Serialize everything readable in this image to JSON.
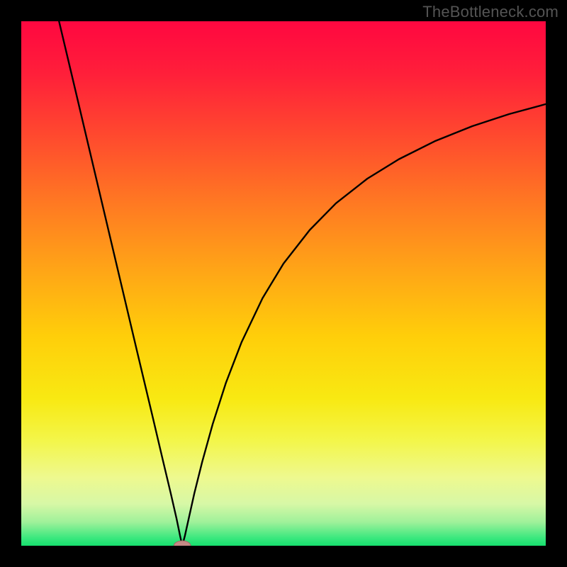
{
  "watermark": "TheBottleneck.com",
  "colors": {
    "frame": "#000000",
    "curve": "#000000",
    "marker_fill": "#c58a86",
    "marker_stroke": "#9f6a66",
    "gradient_stops": [
      {
        "offset": 0.0,
        "color": "#ff0740"
      },
      {
        "offset": 0.1,
        "color": "#ff1f3a"
      },
      {
        "offset": 0.22,
        "color": "#ff4a2e"
      },
      {
        "offset": 0.35,
        "color": "#ff7a22"
      },
      {
        "offset": 0.48,
        "color": "#ffa716"
      },
      {
        "offset": 0.6,
        "color": "#ffce0a"
      },
      {
        "offset": 0.72,
        "color": "#f8e912"
      },
      {
        "offset": 0.8,
        "color": "#f3f64a"
      },
      {
        "offset": 0.87,
        "color": "#eef98f"
      },
      {
        "offset": 0.92,
        "color": "#d7f8a6"
      },
      {
        "offset": 0.955,
        "color": "#9ff19a"
      },
      {
        "offset": 0.985,
        "color": "#3be87e"
      },
      {
        "offset": 1.0,
        "color": "#16e06e"
      }
    ]
  },
  "chart_data": {
    "type": "line",
    "title": "",
    "xlabel": "",
    "ylabel": "",
    "xlim": [
      0,
      100
    ],
    "ylim": [
      0,
      100
    ],
    "grid": false,
    "legend": false,
    "marker": {
      "x": 30.7,
      "y": 0.0,
      "rx": 1.6,
      "ry": 0.95
    },
    "comment": "V-shaped bottleneck curve. x is an arbitrary component-balance parameter (0–100). y is mismatch percentage (0=perfect, 100=worst). Left branch is nearly linear; right branch rises with diminishing slope. Values estimated from pixel positions.",
    "series": [
      {
        "name": "left-branch",
        "x": [
          7.2,
          10,
          13,
          16,
          19,
          22,
          25,
          27,
          28.5,
          29.6,
          30.3,
          30.7
        ],
        "y": [
          100,
          88.2,
          75.5,
          62.8,
          50.1,
          37.4,
          24.8,
          16.3,
          10.0,
          5.2,
          1.8,
          0.0
        ]
      },
      {
        "name": "right-branch",
        "x": [
          30.7,
          31.2,
          32,
          33,
          34.5,
          36.5,
          39,
          42,
          46,
          50,
          55,
          60,
          66,
          72,
          79,
          86,
          93,
          100
        ],
        "y": [
          0.0,
          1.9,
          5.5,
          10.0,
          16.0,
          23.2,
          31.0,
          38.8,
          47.2,
          53.8,
          60.2,
          65.3,
          70.0,
          73.7,
          77.2,
          80.0,
          82.3,
          84.2
        ]
      }
    ]
  }
}
